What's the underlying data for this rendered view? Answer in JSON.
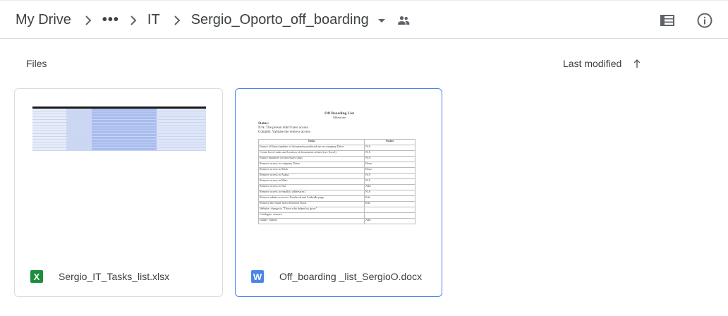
{
  "breadcrumb": {
    "root": "My Drive",
    "overflow": "•••",
    "parent": "IT",
    "current": "Sergio_Oporto_off_boarding"
  },
  "icons": {
    "separator": "chevron-right-icon",
    "current_menu": "arrow-drop-down-icon",
    "shared": "people-icon",
    "list_view": "list-view-icon",
    "details": "info-icon",
    "sort_direction": "arrow-upward-icon"
  },
  "section": {
    "title": "Files",
    "sort_label": "Last modified"
  },
  "files": [
    {
      "name": "Sergio_IT_Tasks_list.xlsx",
      "type_glyph": "X",
      "type_color": "#1e8e3e",
      "selected": false
    },
    {
      "name": "Off_boarding _list_SergioO.docx",
      "type_glyph": "W",
      "type_color": "#4a86e8",
      "selected": true
    }
  ],
  "doc_preview": {
    "title": "Off Boarding List",
    "subtitle": "Milestone",
    "status_heading": "Status:",
    "na_line": "N/A: The person didn't have access",
    "complete_line": "Complet: Validate the remove access",
    "headers": [
      "Tasks",
      "Status"
    ],
    "rows": [
      [
        "Ensure all latest updates of documents produced are on company Drive",
        "N/A"
      ],
      [
        "Create list of tasks and location of documents related (see Excel)",
        "N/A"
      ],
      [
        "Ensure handover for necessary tasks",
        "N/A"
      ],
      [
        "Remove access to company Drive",
        "Done"
      ],
      [
        "Remove access to Slack",
        "Done"
      ],
      [
        "Remove access to Asana",
        "N/A"
      ],
      [
        "Remove access to Miro",
        "N/A"
      ],
      [
        "Remove access to Jira",
        "Adri"
      ],
      [
        "Remove access to email(s) address(es)",
        "N/A"
      ],
      [
        "Remove admin access to Facebook and LinkedIn page",
        "Edu"
      ],
      [
        "Remove the email from #General Slack",
        "Edu"
      ],
      [
        "Website: change to \"Those who helped us grow\"",
        ""
      ],
      [
        "Catalogue: remove",
        ""
      ],
      [
        "Gitlab- Github",
        "Adri"
      ]
    ]
  }
}
